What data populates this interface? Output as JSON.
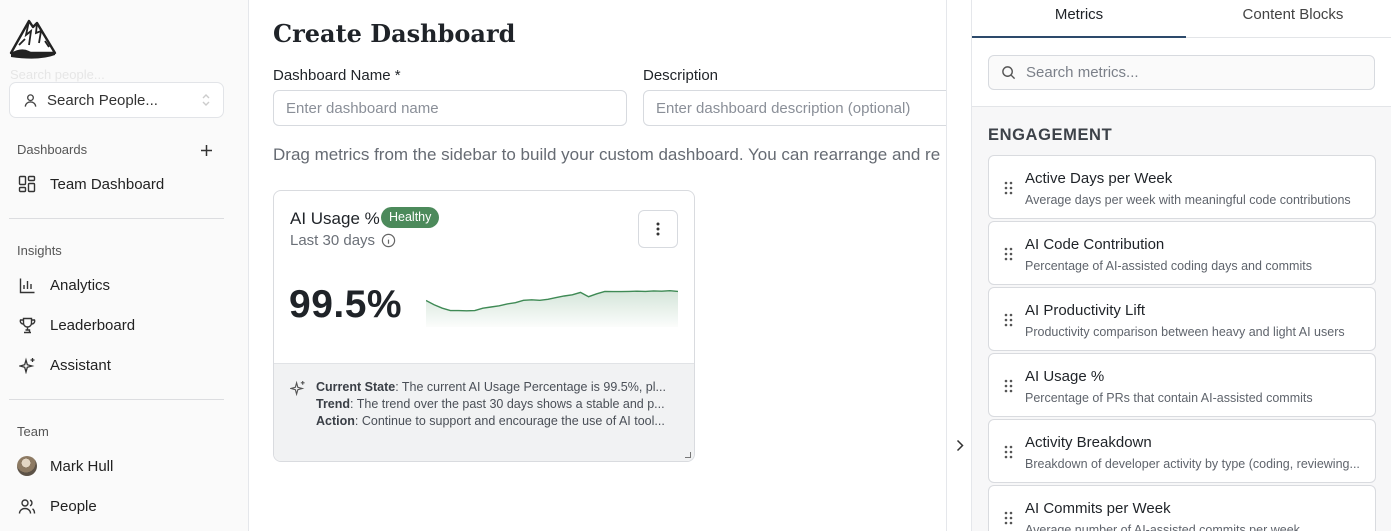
{
  "sidebar": {
    "ghost_label": "Search people...",
    "people_search_label": "Search People...",
    "dashboards_title": "Dashboards",
    "dashboard_items": [
      {
        "label": "Team Dashboard",
        "icon": "dashboard-grid-icon"
      }
    ],
    "insights_title": "Insights",
    "insight_items": [
      {
        "label": "Analytics",
        "icon": "bar-chart-icon"
      },
      {
        "label": "Leaderboard",
        "icon": "trophy-icon"
      },
      {
        "label": "Assistant",
        "icon": "sparkles-icon"
      }
    ],
    "team_title": "Team",
    "team_items": [
      {
        "label": "Mark Hull",
        "icon": "avatar"
      },
      {
        "label": "People",
        "icon": "users-icon"
      }
    ]
  },
  "main": {
    "title": "Create Dashboard",
    "name_label": "Dashboard Name *",
    "name_placeholder": "Enter dashboard name",
    "description_label": "Description",
    "description_placeholder": "Enter dashboard description (optional)",
    "hint": "Drag metrics from the sidebar to build your custom dashboard. You can rearrange and re",
    "card": {
      "title": "AI Usage %",
      "badge": "Healthy",
      "subtitle": "Last 30 days",
      "value": "99.5%",
      "sparkline": [
        0.52,
        0.34,
        0.2,
        0.1,
        0.1,
        0.09,
        0.1,
        0.2,
        0.25,
        0.3,
        0.38,
        0.43,
        0.53,
        0.55,
        0.53,
        0.57,
        0.64,
        0.71,
        0.76,
        0.86,
        0.68,
        0.8,
        0.9,
        0.89,
        0.89,
        0.9,
        0.91,
        0.9,
        0.92,
        0.91,
        0.93,
        0.9
      ],
      "insights": [
        {
          "label": "Current State",
          "text": ": The current AI Usage Percentage is 99.5%, pl..."
        },
        {
          "label": "Trend",
          "text": ": The trend over the past 30 days shows a stable and p..."
        },
        {
          "label": "Action",
          "text": ": Continue to support and encourage the use of AI tool..."
        }
      ]
    }
  },
  "panel": {
    "tabs": [
      {
        "label": "Metrics",
        "active": true
      },
      {
        "label": "Content Blocks",
        "active": false
      }
    ],
    "search_placeholder": "Search metrics...",
    "category": "ENGAGEMENT",
    "metrics": [
      {
        "name": "Active Days per Week",
        "desc": "Average days per week with meaningful code contributions"
      },
      {
        "name": "AI Code Contribution",
        "desc": "Percentage of AI-assisted coding days and commits"
      },
      {
        "name": "AI Productivity Lift",
        "desc": "Productivity comparison between heavy and light AI users"
      },
      {
        "name": "AI Usage %",
        "desc": "Percentage of PRs that contain AI-assisted commits"
      },
      {
        "name": "Activity Breakdown",
        "desc": "Breakdown of developer activity by type (coding, reviewing..."
      },
      {
        "name": "AI Commits per Week",
        "desc": "Average number of AI-assisted commits per week"
      }
    ]
  },
  "colors": {
    "badge": "#4c8a5b",
    "sparkline": "#3f8a55",
    "tab_underline": "#2d4a6b"
  }
}
